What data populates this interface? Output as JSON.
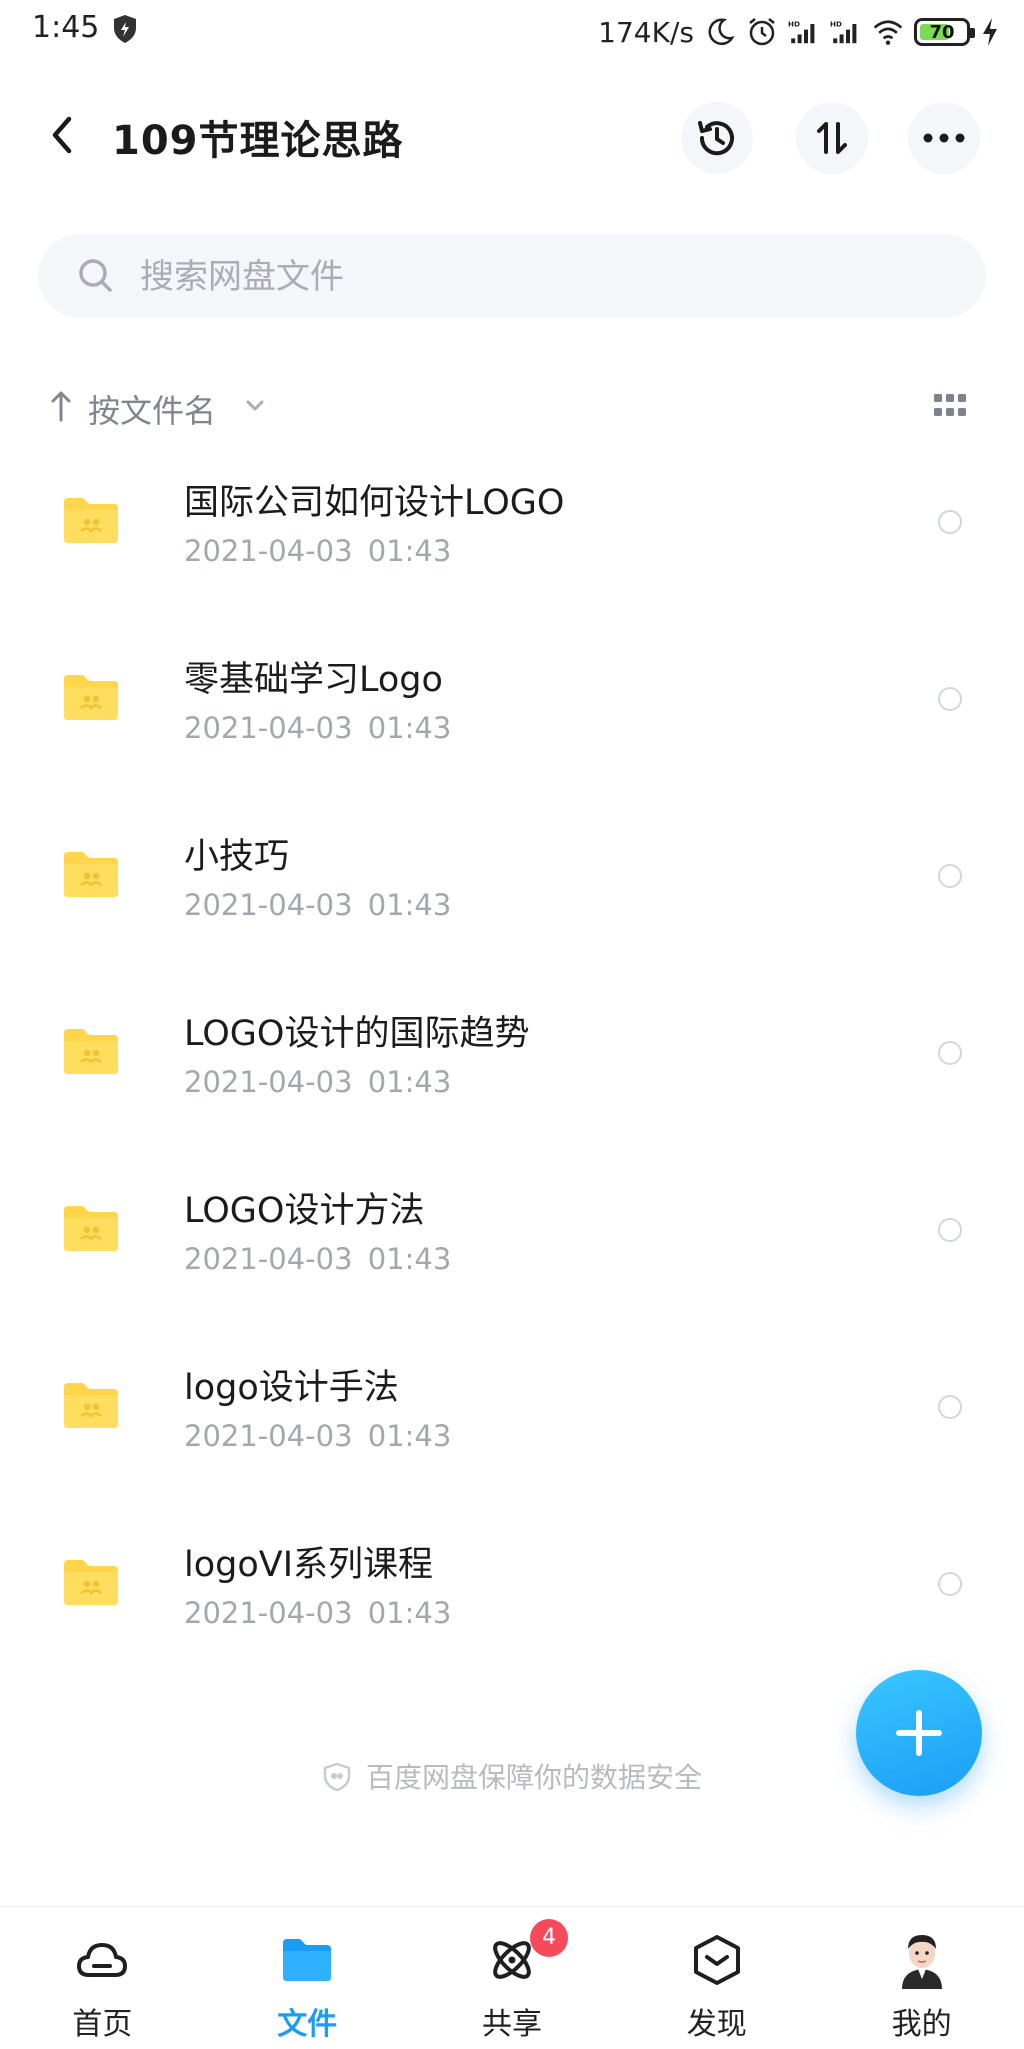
{
  "status_bar": {
    "time": "1:45",
    "net_speed": "174K/s",
    "battery": 70
  },
  "header": {
    "title": "109节理论思路",
    "back_icon": "chevron-left-icon",
    "actions": [
      "history-icon",
      "sort-updown-icon",
      "more-icon"
    ]
  },
  "search": {
    "placeholder": "搜索网盘文件",
    "value": ""
  },
  "sort": {
    "label": "按文件名"
  },
  "files": [
    {
      "name": "国际公司如何设计LOGO",
      "date": "2021-04-03 01:43",
      "type": "shared-folder"
    },
    {
      "name": "零基础学习Logo",
      "date": "2021-04-03 01:43",
      "type": "shared-folder"
    },
    {
      "name": "小技巧",
      "date": "2021-04-03 01:43",
      "type": "shared-folder"
    },
    {
      "name": "LOGO设计的国际趋势",
      "date": "2021-04-03 01:43",
      "type": "shared-folder"
    },
    {
      "name": "LOGO设计方法",
      "date": "2021-04-03 01:43",
      "type": "shared-folder"
    },
    {
      "name": "logo设计手法",
      "date": "2021-04-03 01:43",
      "type": "shared-folder"
    },
    {
      "name": "logoVI系列课程",
      "date": "2021-04-03 01:43",
      "type": "shared-folder"
    }
  ],
  "footer_note": "百度网盘保障你的数据安全",
  "bottom_nav": {
    "items": [
      {
        "label": "首页",
        "icon": "cloud-icon",
        "active": false
      },
      {
        "label": "文件",
        "icon": "folder-icon",
        "active": true
      },
      {
        "label": "共享",
        "icon": "share-atom-icon",
        "active": false
      },
      {
        "label": "发现",
        "icon": "discover-box-icon",
        "active": false
      },
      {
        "label": "我的",
        "icon": "avatar-icon",
        "active": false
      }
    ],
    "share_badge": "4"
  },
  "colors": {
    "accent": "#1a9df5",
    "folder": "#ffd54a",
    "badge": "#f44a5c"
  }
}
